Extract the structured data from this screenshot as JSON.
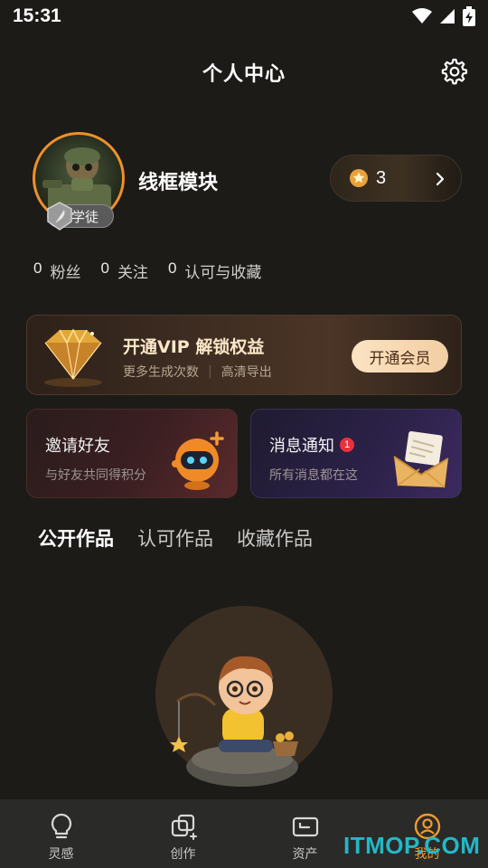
{
  "status_bar": {
    "time": "15:31"
  },
  "header": {
    "title": "个人中心"
  },
  "profile": {
    "username": "线框模块",
    "rank": "学徒",
    "coins": "3"
  },
  "stats": [
    {
      "count": "0",
      "label": "粉丝"
    },
    {
      "count": "0",
      "label": "关注"
    },
    {
      "count": "0",
      "label": "认可与收藏"
    }
  ],
  "vip": {
    "title": "开通VIP 解锁权益",
    "benefit_1": "更多生成次数",
    "separator": "|",
    "benefit_2": "高清导出",
    "button": "开通会员"
  },
  "cards": {
    "invite": {
      "title": "邀请好友",
      "subtitle": "与好友共同得积分"
    },
    "messages": {
      "title": "消息通知",
      "badge": "1",
      "subtitle": "所有消息都在这"
    }
  },
  "tabs": [
    {
      "label": "公开作品",
      "active": true
    },
    {
      "label": "认可作品",
      "active": false
    },
    {
      "label": "收藏作品",
      "active": false
    }
  ],
  "bottom_nav": [
    {
      "label": "灵感",
      "icon": "lightbulb-icon"
    },
    {
      "label": "创作",
      "icon": "create-icon"
    },
    {
      "label": "资产",
      "icon": "wallet-icon"
    },
    {
      "label": "我的",
      "icon": "profile-icon",
      "active": true
    }
  ],
  "watermark": "ITMOP.COM",
  "colors": {
    "background": "#1c1b17",
    "accent_orange": "#f29a2e",
    "vip_button": "#f2cea2",
    "notification_red": "#e8313b",
    "watermark": "#22b8c8"
  }
}
